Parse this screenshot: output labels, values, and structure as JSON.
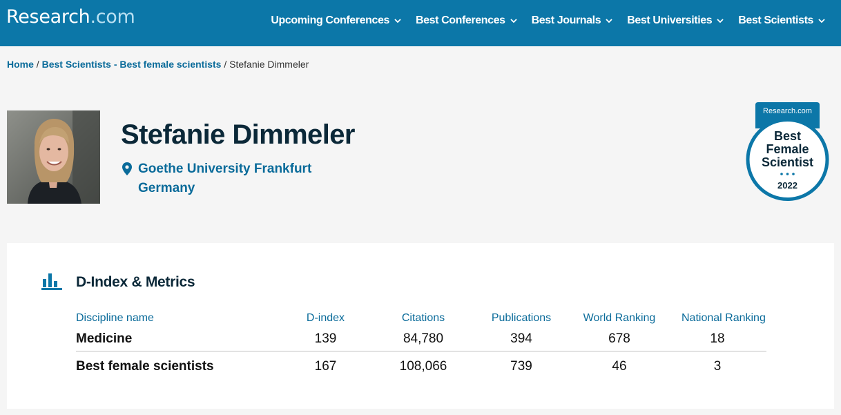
{
  "header": {
    "logo_main": "Research",
    "logo_domain": ".com",
    "nav": [
      {
        "label": "Upcoming Conferences"
      },
      {
        "label": "Best Conferences"
      },
      {
        "label": "Best Journals"
      },
      {
        "label": "Best Universities"
      },
      {
        "label": "Best Scientists"
      }
    ]
  },
  "breadcrumb": {
    "home": "Home",
    "sep1": " / ",
    "section": "Best Scientists - Best female scientists",
    "sep2": " / ",
    "current": "Stefanie Dimmeler"
  },
  "profile": {
    "name": "Stefanie Dimmeler",
    "university": "Goethe University Frankfurt",
    "country": "Germany"
  },
  "badge": {
    "brand": "Research.com",
    "line1": "Best",
    "line2": "Female",
    "line3": "Scientist",
    "year": "2022"
  },
  "metrics": {
    "title": "D-Index & Metrics",
    "columns": [
      "Discipline name",
      "D-index",
      "Citations",
      "Publications",
      "World Ranking",
      "National Ranking"
    ],
    "rows": [
      [
        "Medicine",
        "139",
        "84,780",
        "394",
        "678",
        "18"
      ],
      [
        "Best female scientists",
        "167",
        "108,066",
        "739",
        "46",
        "3"
      ]
    ]
  },
  "colors": {
    "header_bg": "#0c77a8",
    "link": "#0a6b9a",
    "heading": "#0b2838",
    "page_bg": "#f5f5f5"
  }
}
